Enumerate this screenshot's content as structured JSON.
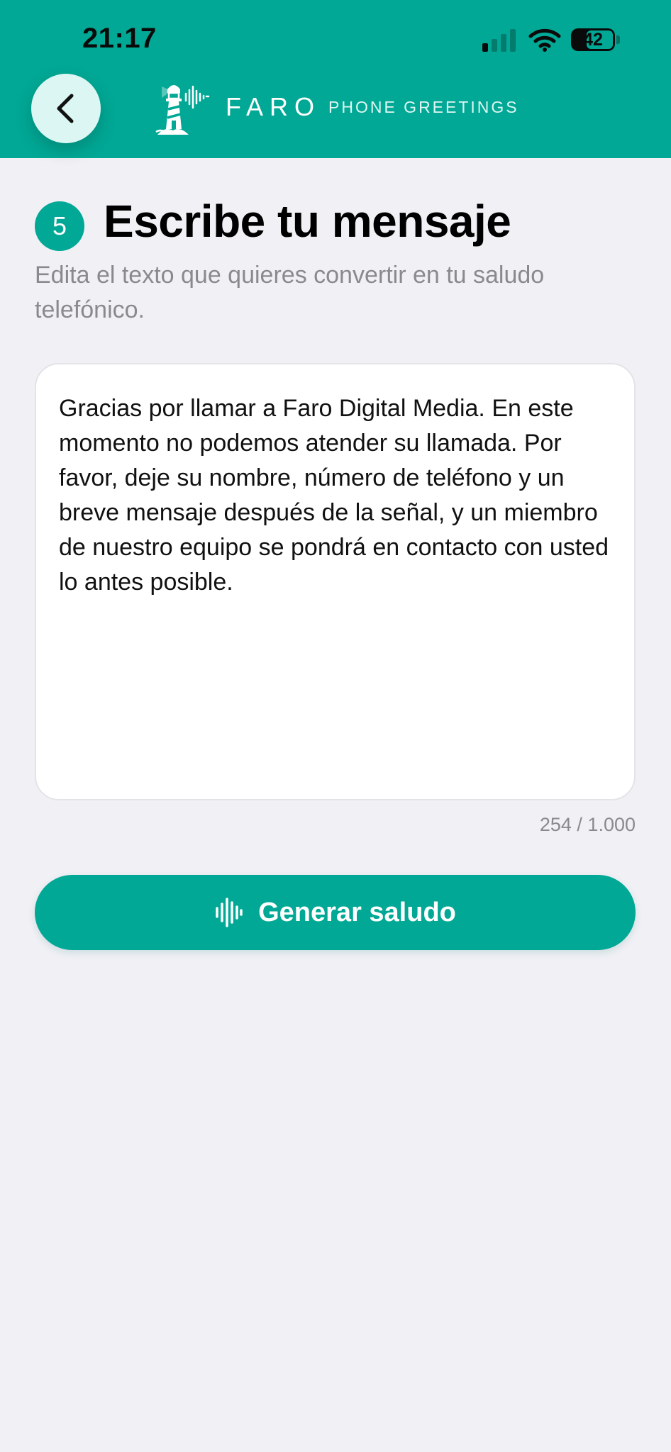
{
  "status_bar": {
    "time": "21:17",
    "battery_level": "42",
    "signal_icon": "cellular-signal-icon",
    "wifi_icon": "wifi-icon",
    "battery_icon": "battery-icon"
  },
  "header": {
    "back_icon": "chevron-left-icon",
    "logo_icon": "lighthouse-logo-icon",
    "brand_name": "FARO",
    "brand_subtitle": "PHONE GREETINGS",
    "background_color": "#00a895"
  },
  "step": {
    "number": "5",
    "title": "Escribe tu mensaje",
    "subtitle": "Edita el texto que quieres convertir en tu saludo telefónico."
  },
  "message": {
    "value": "Gracias por llamar a Faro Digital Media. En este momento no podemos atender su llamada. Por favor, deje su nombre, número de teléfono y un breve mensaje después de la señal, y un miembro de nuestro equipo se pondrá en contacto con usted lo antes posible.",
    "char_count": "254 / 1.000"
  },
  "generate_button": {
    "label": "Generar saludo",
    "icon": "waveform-icon"
  },
  "colors": {
    "accent": "#00a895",
    "back_button_bg": "#dcf7f3",
    "page_bg": "#f0f0f5"
  }
}
